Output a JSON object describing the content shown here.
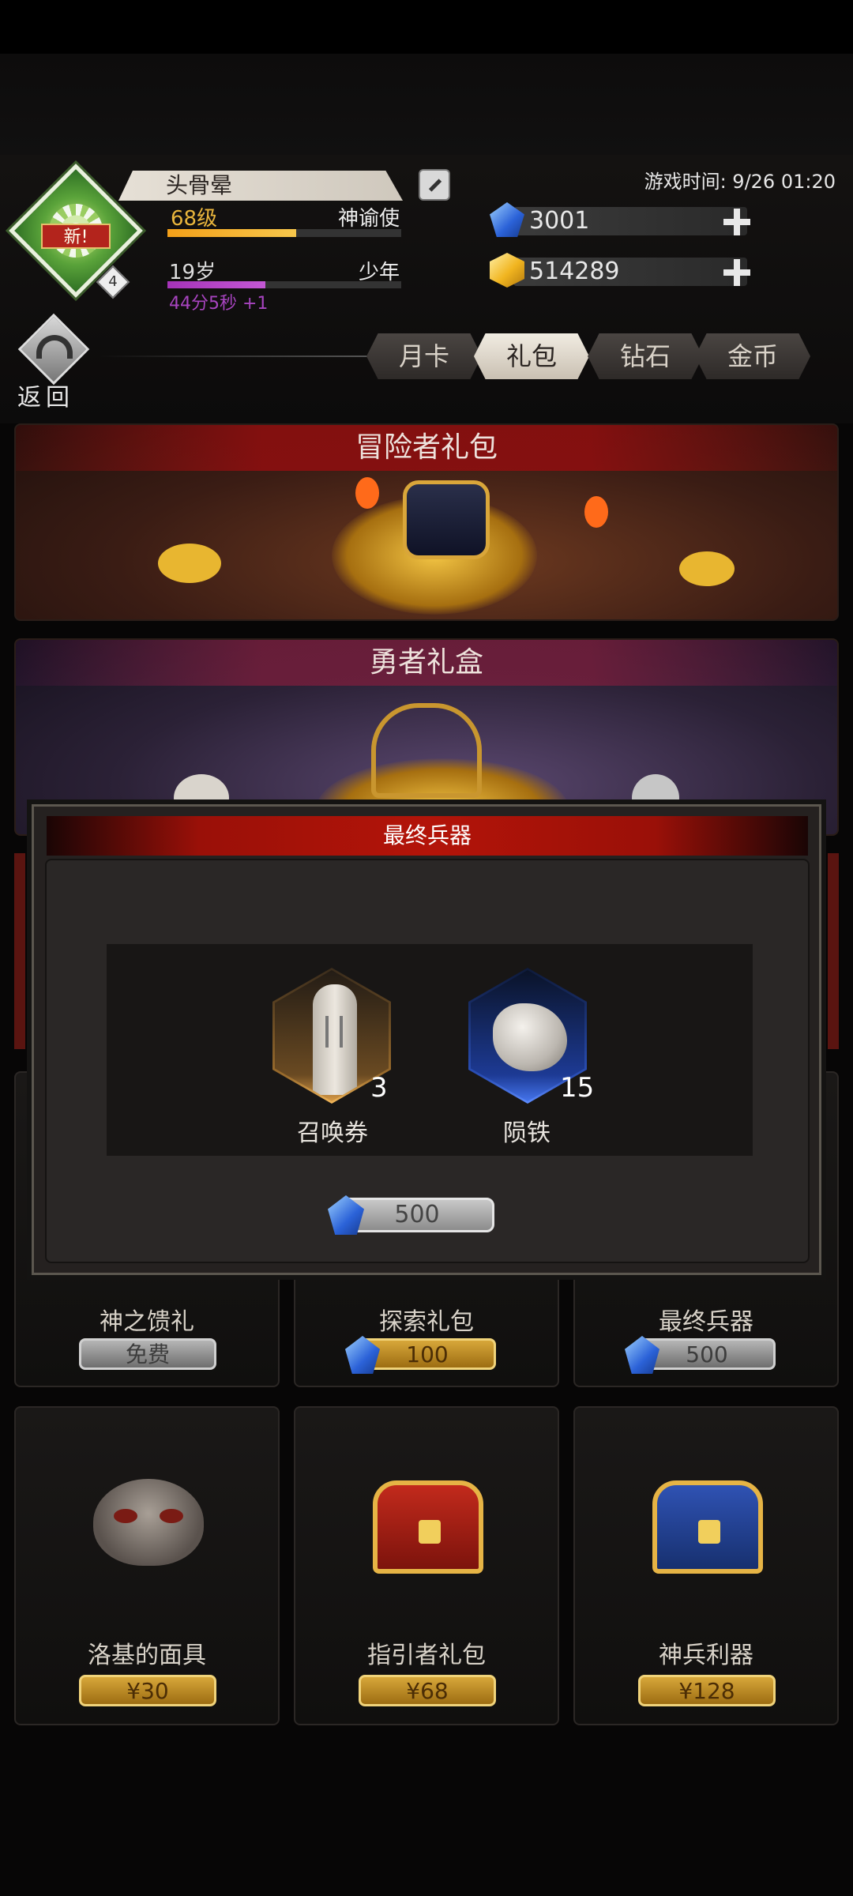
{
  "player": {
    "name": "头骨晕",
    "new_badge": "新!",
    "avatar_level": "4",
    "level": "68级",
    "title": "神谕使",
    "age": "19岁",
    "age_stage": "少年",
    "age_timer": "44分5秒 +1",
    "level_progress": 0.55,
    "age_progress": 0.42
  },
  "game_time": "游戏时间: 9/26 01:20",
  "currency": {
    "diamonds": "3001",
    "gold": "514289"
  },
  "back_label": "返回",
  "tabs": [
    {
      "label": "月卡",
      "active": false
    },
    {
      "label": "礼包",
      "active": true
    },
    {
      "label": "钻石",
      "active": false
    },
    {
      "label": "金币",
      "active": false
    }
  ],
  "banners": [
    {
      "title": "冒险者礼包"
    },
    {
      "title": "勇者礼盒"
    }
  ],
  "grid": {
    "row1": [
      {
        "name": "神之馈礼",
        "price": "免费",
        "currency": "free"
      },
      {
        "name": "探索礼包",
        "price": "100",
        "currency": "diamond"
      },
      {
        "name": "最终兵器",
        "price": "500",
        "currency": "diamond"
      }
    ],
    "row2": [
      {
        "name": "洛基的面具",
        "price": "¥30",
        "icon": "mask-icon"
      },
      {
        "name": "指引者礼包",
        "price": "¥68",
        "icon": "red-chest-icon"
      },
      {
        "name": "神兵利器",
        "price": "¥128",
        "icon": "blue-chest-icon"
      }
    ]
  },
  "modal": {
    "title": "最终兵器",
    "rewards": [
      {
        "name": "召唤券",
        "qty": "3",
        "icon": "summon-ticket-icon"
      },
      {
        "name": "陨铁",
        "qty": "15",
        "icon": "meteorite-icon"
      }
    ],
    "price": "500"
  },
  "colors": {
    "accent_red": "#b31409",
    "gold": "#e9b53c",
    "level_bar": "#f4a019",
    "age_bar": "#a533b8",
    "diamond": "#2b62d8"
  }
}
